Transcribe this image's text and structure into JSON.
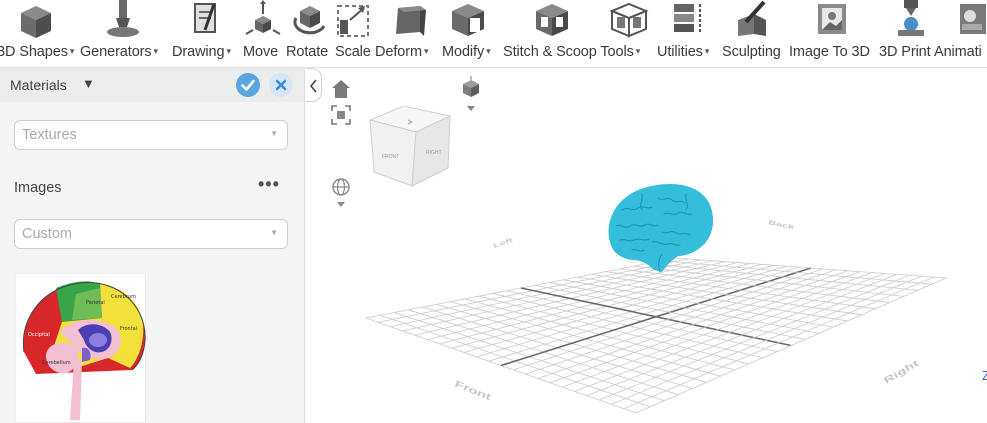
{
  "toolbar": {
    "menus": [
      {
        "label": "3D Shapes",
        "has_dropdown": true
      },
      {
        "label": "Generators",
        "has_dropdown": true
      },
      {
        "label": "Drawing",
        "has_dropdown": true
      },
      {
        "label": "Move",
        "has_dropdown": false
      },
      {
        "label": "Rotate",
        "has_dropdown": false
      },
      {
        "label": "Scale",
        "has_dropdown": false
      },
      {
        "label": "Deform",
        "has_dropdown": true
      },
      {
        "label": "Modify",
        "has_dropdown": true
      },
      {
        "label": "Stitch & Scoop Tools",
        "has_dropdown": true
      },
      {
        "label": "Utilities",
        "has_dropdown": true
      },
      {
        "label": "Sculpting",
        "has_dropdown": false
      },
      {
        "label": "Image To 3D",
        "has_dropdown": false
      },
      {
        "label": "3D Print",
        "has_dropdown": false
      },
      {
        "label": "Animati",
        "has_dropdown": false
      }
    ],
    "caret": "▾",
    "icons": [
      "cube-icon",
      "stamp-icon",
      "drawing-icon",
      "move-icon",
      "rotate-icon",
      "scale-icon",
      "deform-icon",
      "modify-icon",
      "stitch-icon",
      "scoop-icon",
      "utilities-icon",
      "sculpt-icon",
      "image-to-3d-icon",
      "print-icon",
      "animation-icon"
    ]
  },
  "panel": {
    "title": "Materials",
    "title_caret": "▼",
    "confirm_icon": "check-icon",
    "close_icon": "close-icon",
    "textures_placeholder": "Textures",
    "images_label": "Images",
    "images_more": "•••",
    "custom_placeholder": "Custom",
    "select_caret": "▼"
  },
  "viewport": {
    "collapse_glyph": "‹",
    "home_icon": "home-icon",
    "fit_icon": "fit-view-icon",
    "view_dropdown_icon": "view-cube-icon",
    "globe_icon": "globe-icon",
    "view_cube_faces": {
      "front": "FRONT",
      "right": "RIGHT"
    },
    "axis_labels": {
      "front": "Front",
      "left": "Left",
      "back": "Back",
      "right": "Right"
    },
    "model_color": "#34bedc",
    "stray_glyph": "Z"
  },
  "colors": {
    "accent": "#5aa6e0",
    "grid": "#c9c9c9",
    "grid_axis": "#6a6a6a"
  }
}
